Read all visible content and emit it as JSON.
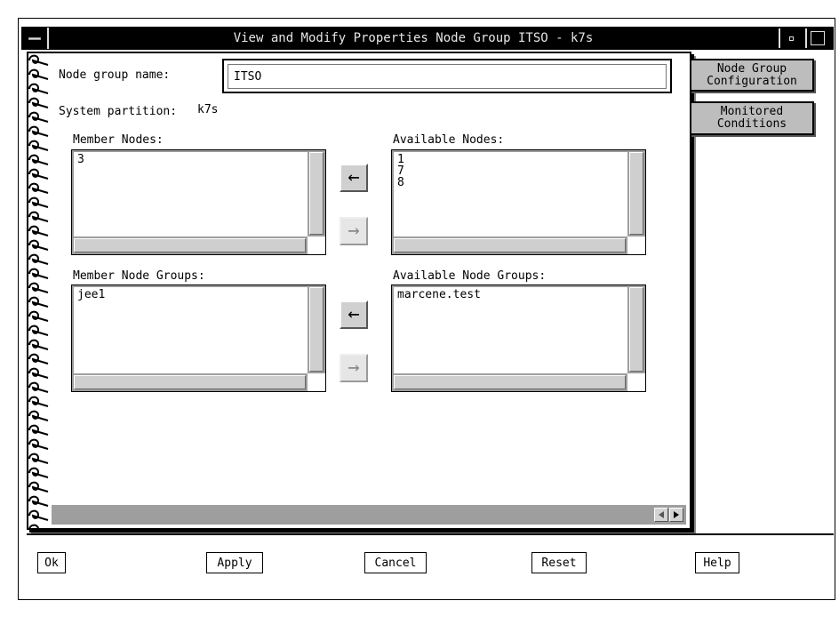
{
  "window": {
    "title": "View and Modify Properties Node Group ITSO - k7s"
  },
  "form": {
    "node_group_name_label": "Node group name:",
    "node_group_name_value": "ITSO",
    "system_partition_label": "System partition:",
    "system_partition_value": "k7s"
  },
  "member_nodes": {
    "label": "Member Nodes:",
    "items": [
      "3"
    ]
  },
  "available_nodes": {
    "label": "Available Nodes:",
    "items": [
      "1",
      "7",
      "8"
    ]
  },
  "member_node_groups": {
    "label": "Member Node Groups:",
    "items": [
      "jee1"
    ]
  },
  "available_node_groups": {
    "label": "Available Node Groups:",
    "items": [
      "marcene.test"
    ]
  },
  "arrows": {
    "add": "←",
    "remove": "→"
  },
  "tabs": [
    {
      "label": "Node Group Configuration",
      "line1": "Node Group",
      "line2": "Configuration",
      "selected": true
    },
    {
      "label": "Monitored Conditions",
      "line1": "Monitored",
      "line2": "Conditions",
      "selected": false
    }
  ],
  "buttons": {
    "ok": "Ok",
    "apply": "Apply",
    "cancel": "Cancel",
    "reset": "Reset",
    "help": "Help"
  },
  "icons": {
    "window_menu": "window-menu-icon",
    "minimize": "minimize-icon",
    "maximize": "maximize-icon",
    "spiral": "spiral-binding-icon",
    "left_arrow": "arrow-left-icon",
    "right_arrow": "arrow-right-icon"
  },
  "colors": {
    "title_bar": "#000000",
    "scroll_track": "#9e9e9e",
    "tab_bg": "#bdbdbd"
  }
}
